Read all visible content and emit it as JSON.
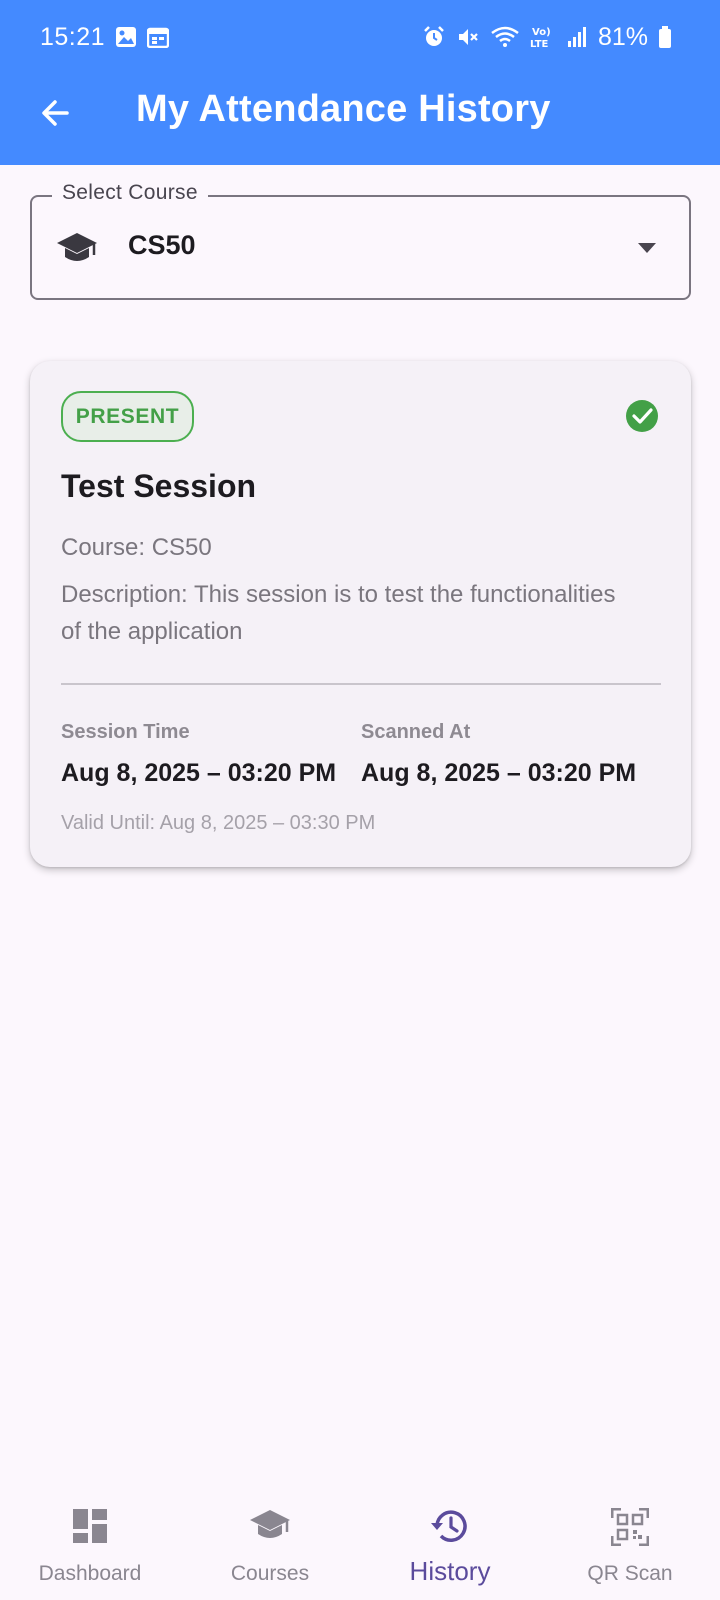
{
  "status_bar": {
    "time": "15:21",
    "battery": "81%",
    "icons": [
      "gallery-icon",
      "calendar-icon",
      "alarm-icon",
      "mute-icon",
      "wifi-icon",
      "volte-icon",
      "signal-icon",
      "battery-icon"
    ]
  },
  "app_bar": {
    "title": "My Attendance History",
    "back_icon": "arrow-back-icon",
    "color": "#448AFF"
  },
  "course_select": {
    "label": "Select Course",
    "value": "CS50",
    "icon": "graduation-cap-icon"
  },
  "records": [
    {
      "status": "PRESENT",
      "status_color": "#43A047",
      "title": "Test Session",
      "course": "Course: CS50",
      "description": "Description: This session is to test the functionalities of the application",
      "session_time_label": "Session Time",
      "session_time": "Aug 8, 2025 – 03:20 PM",
      "scanned_at_label": "Scanned At",
      "scanned_at": "Aug 8, 2025 – 03:20 PM",
      "valid_until": "Valid Until: Aug 8, 2025 – 03:30 PM"
    }
  ],
  "bottom_nav": {
    "items": [
      {
        "label": "Dashboard",
        "icon": "dashboard-icon",
        "active": false
      },
      {
        "label": "Courses",
        "icon": "graduation-cap-icon",
        "active": false
      },
      {
        "label": "History",
        "icon": "history-icon",
        "active": true
      },
      {
        "label": "QR Scan",
        "icon": "qr-scan-icon",
        "active": false
      }
    ],
    "active_color": "#5B4B9C"
  }
}
